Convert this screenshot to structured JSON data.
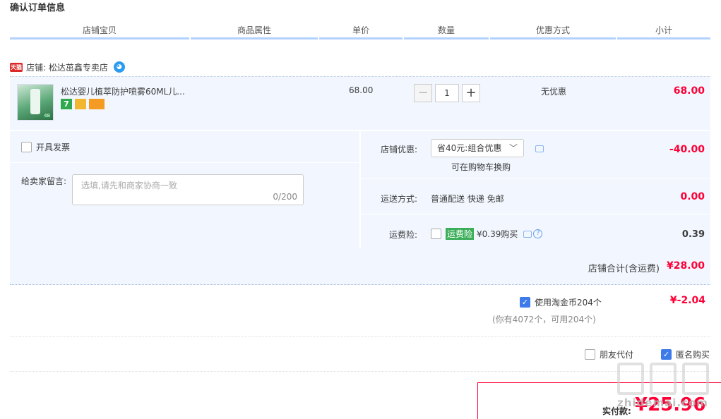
{
  "page_title": "确认订单信息",
  "columns": [
    "店铺宝贝",
    "商品属性",
    "单价",
    "数量",
    "优惠方式",
    "小计"
  ],
  "shop": {
    "badge": "天猫",
    "name": "店铺: 松达茁鑫专卖店"
  },
  "item": {
    "title": "松达婴儿植萃防护喷雾60ML儿...",
    "service_badge_1": "7",
    "unit_price": "68.00",
    "quantity": "1",
    "minus": "−",
    "plus": "+",
    "promotion": "无优惠",
    "subtotal": "68.00",
    "thumb_badge": "48"
  },
  "invoice_label": "开具发票",
  "message": {
    "label": "给卖家留言:",
    "placeholder": "选填,请先和商家协商一致",
    "counter": "0/200"
  },
  "shop_discount": {
    "label": "店铺优惠:",
    "selected": "省40元:组合优惠",
    "hint": "可在购物车换购",
    "amount": "-40.00"
  },
  "shipping": {
    "label": "运送方式:",
    "value": "普通配送 快递 免邮",
    "amount": "0.00"
  },
  "shipping_insurance": {
    "label": "运费险:",
    "tag": "运费险",
    "price": "¥0.39购买",
    "amount": "0.39"
  },
  "shop_total": {
    "label": "店铺合计(含运费)",
    "amount": "¥28.00"
  },
  "coins": {
    "label": "使用淘金币204个",
    "note": "(你有4072个，可用204个)",
    "amount": "¥-2.04",
    "checked": true
  },
  "options": {
    "friend_pay": "朋友代付",
    "anonymous": "匿名购买"
  },
  "payment": {
    "label": "实付款:",
    "amount": "¥25.96"
  },
  "watermark": "zhidemai.com",
  "colors": {
    "accent_red": "#ff0036",
    "header_line": "#b2d1ff",
    "row_bg": "#f2f7ff",
    "checkbox_blue": "#3e7bea",
    "insurance_green": "#3cae59"
  }
}
